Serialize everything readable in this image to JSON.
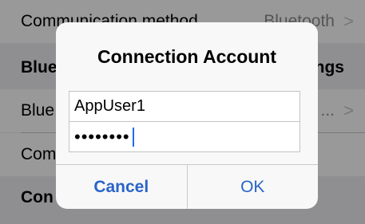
{
  "background_list": {
    "rows": [
      {
        "label": "Communication method",
        "value": "Bluetooth"
      },
      {
        "label": "Blue",
        "value": "ngs"
      },
      {
        "label": "Blue",
        "value": "..."
      },
      {
        "label": "Com",
        "value": ""
      },
      {
        "label": "Con",
        "value": ""
      }
    ],
    "chevron": ">"
  },
  "dialog": {
    "title": "Connection Account",
    "username_value": "AppUser1",
    "password_value": "••••••••",
    "cancel_label": "Cancel",
    "ok_label": "OK"
  },
  "colors": {
    "accent": "#2a64c8",
    "caret": "#1a6ef5"
  }
}
